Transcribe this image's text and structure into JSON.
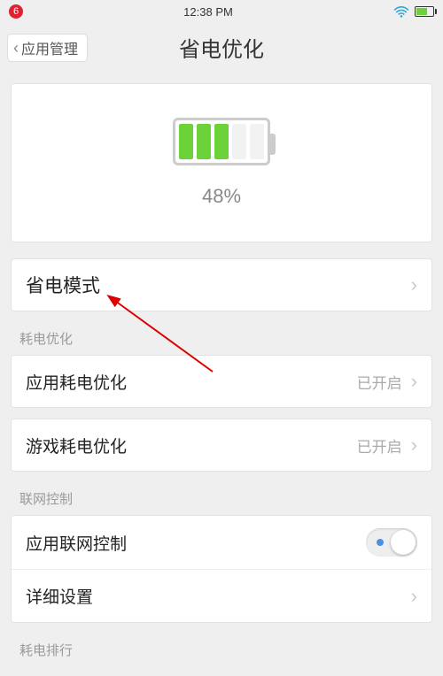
{
  "statusbar": {
    "notification_count": "6",
    "time": "12:38 PM"
  },
  "nav": {
    "back_label": "应用管理",
    "title": "省电优化"
  },
  "battery": {
    "percent_label": "48%",
    "fill_cells": 3,
    "total_cells": 5,
    "filled_color": "#6cd23a",
    "empty_color": "#f2f2f2"
  },
  "rows": {
    "power_mode": {
      "label": "省电模式"
    },
    "section_power": "耗电优化",
    "app_opt": {
      "label": "应用耗电优化",
      "status": "已开启"
    },
    "game_opt": {
      "label": "游戏耗电优化",
      "status": "已开启"
    },
    "section_net": "联网控制",
    "net_ctrl": {
      "label": "应用联网控制",
      "toggle_on": false
    },
    "net_detail": {
      "label": "详细设置"
    },
    "section_rank": "耗电排行"
  }
}
